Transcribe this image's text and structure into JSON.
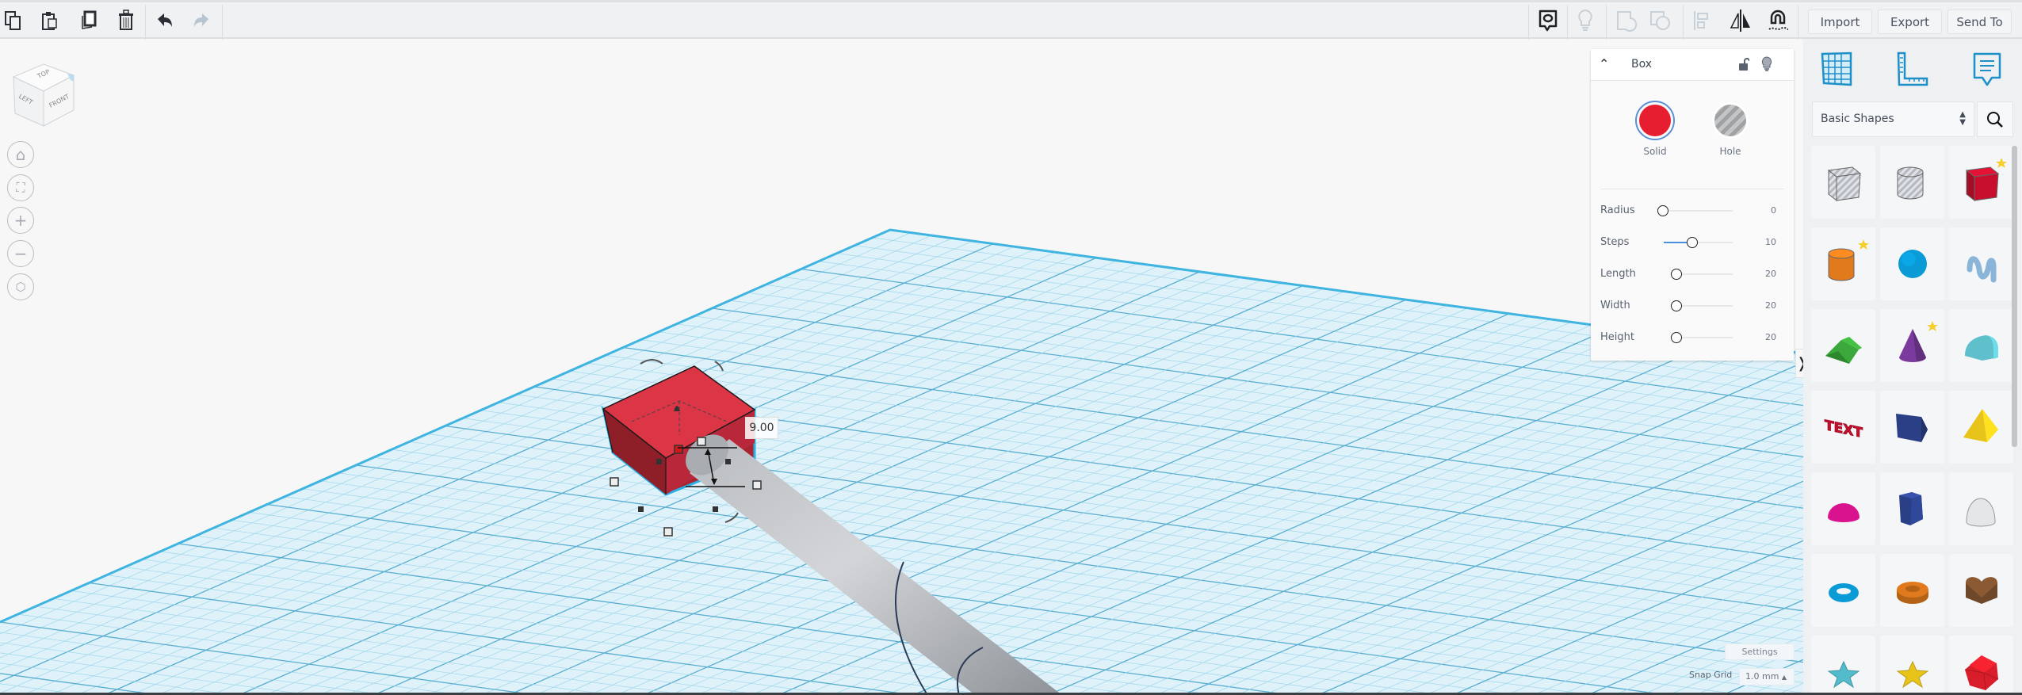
{
  "toolbar": {
    "left_icons": [
      "copy-icon",
      "paste-icon",
      "duplicate-icon",
      "delete-icon"
    ],
    "history_icons": [
      "undo-icon",
      "redo-icon"
    ],
    "right_icons": [
      "notes-icon",
      "visibility-icon",
      "group-icon",
      "ungroup-icon",
      "align-icon",
      "mirror-icon",
      "cruise-icon"
    ],
    "import_label": "Import",
    "export_label": "Export",
    "send_to_label": "Send To"
  },
  "view_cube": {
    "top": "TOP",
    "left": "LEFT",
    "front": "FRONT"
  },
  "nav_buttons": [
    "home-icon",
    "fit-icon",
    "zoom-in-icon",
    "zoom-out-icon",
    "perspective-icon"
  ],
  "workplane": {
    "dimension_value": "9.00",
    "settings_label": "Settings",
    "snap_grid_label": "Snap Grid",
    "snap_grid_value": "1.0 mm"
  },
  "inspector": {
    "title": "Box",
    "solid_label": "Solid",
    "hole_label": "Hole",
    "solid_color": "#e61e30",
    "params": [
      {
        "label": "Radius",
        "value": "0",
        "fraction": 0.0
      },
      {
        "label": "Steps",
        "value": "10",
        "fraction": 0.45
      },
      {
        "label": "Length",
        "value": "20",
        "fraction": 0.1
      },
      {
        "label": "Width",
        "value": "20",
        "fraction": 0.1
      },
      {
        "label": "Height",
        "value": "20",
        "fraction": 0.1
      }
    ]
  },
  "library": {
    "tabs": [
      "workplane-icon",
      "ruler-icon",
      "notes-icon"
    ],
    "category": "Basic Shapes",
    "shapes": [
      {
        "name": "Box Hole",
        "type": "box",
        "color": "#c8ccd2",
        "hole": true
      },
      {
        "name": "Cylinder Hole",
        "type": "cyl",
        "color": "#c8ccd2",
        "hole": true
      },
      {
        "name": "Box",
        "type": "box",
        "color": "#c8102e",
        "star": true
      },
      {
        "name": "Cylinder",
        "type": "cyl",
        "color": "#e07a1c",
        "star": true
      },
      {
        "name": "Sphere",
        "type": "sphere",
        "color": "#0a9ad6"
      },
      {
        "name": "Scribble",
        "type": "scribble",
        "color": "#8ab4d8"
      },
      {
        "name": "Roof",
        "type": "roof",
        "color": "#3aa83a"
      },
      {
        "name": "Cone",
        "type": "cone",
        "color": "#7b3b9e",
        "star": true
      },
      {
        "name": "Round Roof",
        "type": "rroof",
        "color": "#5fc0cc"
      },
      {
        "name": "Text",
        "type": "text",
        "color": "#c8102e",
        "label": "TEXT"
      },
      {
        "name": "Polygon",
        "type": "poly",
        "color": "#2a3f86"
      },
      {
        "name": "Pyramid",
        "type": "pyramid",
        "color": "#e8c41a"
      },
      {
        "name": "Half Sphere",
        "type": "half",
        "color": "#d9128e"
      },
      {
        "name": "Hexagonal Prism",
        "type": "hex",
        "color": "#2a3f86"
      },
      {
        "name": "Paraboloid",
        "type": "para",
        "color": "#e4e6e8"
      },
      {
        "name": "Torus",
        "type": "torus",
        "color": "#0a9ad6"
      },
      {
        "name": "Tube",
        "type": "tube",
        "color": "#e07a1c"
      },
      {
        "name": "Heart",
        "type": "heart",
        "color": "#8b5a33"
      },
      {
        "name": "Star",
        "type": "star",
        "color": "#52bccc"
      },
      {
        "name": "Star Six",
        "type": "star",
        "color": "#e8c41a"
      },
      {
        "name": "Icosahedron",
        "type": "ico",
        "color": "#d81e2a"
      }
    ]
  }
}
